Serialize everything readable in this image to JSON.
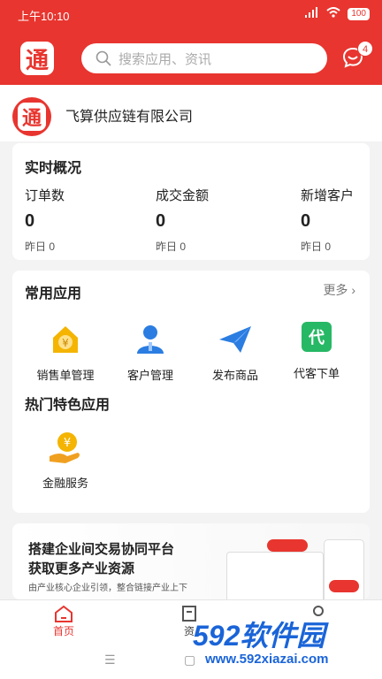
{
  "status_bar": {
    "time": "上午10:10",
    "battery": "100"
  },
  "header": {
    "logo_char": "通",
    "search_placeholder": "搜索应用、资讯",
    "message_badge": "4"
  },
  "company": {
    "avatar_char": "通",
    "name": "飞算供应链有限公司"
  },
  "realtime": {
    "title": "实时概况",
    "stats": [
      {
        "label": "订单数",
        "value": "0",
        "sub": "昨日 0"
      },
      {
        "label": "成交金额",
        "value": "0",
        "sub": "昨日 0"
      },
      {
        "label": "新增客户",
        "value": "0",
        "sub": "昨日 0"
      }
    ]
  },
  "common_apps": {
    "title": "常用应用",
    "more": "更多",
    "items": [
      {
        "label": "销售单管理",
        "icon": "sales-order-icon"
      },
      {
        "label": "客户管理",
        "icon": "customer-icon"
      },
      {
        "label": "发布商品",
        "icon": "paper-plane-icon"
      },
      {
        "label": "代客下单",
        "icon": "proxy-order-icon",
        "icon_text": "代"
      }
    ]
  },
  "hot_apps": {
    "title": "热门特色应用",
    "items": [
      {
        "label": "金融服务",
        "icon": "finance-icon"
      }
    ]
  },
  "banner": {
    "line1": "搭建企业间交易协同平台",
    "line2": "获取更多产业资源",
    "line3": "由产业核心企业引领，整合链接产业上下"
  },
  "tabbar": {
    "home": "首页",
    "info": "资"
  },
  "watermark": {
    "text": "592软件园",
    "url": "www.592xiazai.com"
  },
  "colors": {
    "brand": "#e8352f",
    "gold": "#f4b400"
  }
}
